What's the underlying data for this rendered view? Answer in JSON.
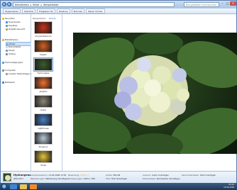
{
  "window": {
    "breadcrumbs": [
      "Bibliotheken",
      "Bilder",
      "Beispielbilder"
    ],
    "search_placeholder": "Beispielbilder durchsuchen",
    "minimize": "–",
    "maximize": "□",
    "close": "✕"
  },
  "toolbar": {
    "items": [
      "Organisieren",
      "Diashow",
      "Freigeben für",
      "Diashow",
      "Brennen",
      "Neuer Ordner"
    ]
  },
  "navpane": {
    "favorites": "Favoriten",
    "fav_items": [
      "Downloads",
      "Desktop",
      "Zuletzt besucht"
    ],
    "libraries": "Bibliotheken",
    "lib_items": [
      "Bilder",
      "Dokumente",
      "Musik",
      "Videos"
    ],
    "homegroup": "Heimnetzgruppe",
    "computer": "Computer",
    "computer_items": [
      "Lokaler Datenträger (C:)"
    ],
    "network": "Netzwerk"
  },
  "filmstrip": {
    "header": "Beispielbilder",
    "arrange_label": "Ordner",
    "items": [
      {
        "label": "Chrysanthemum",
        "color": "#c8351b"
      },
      {
        "label": "Desert",
        "color": "#d2611f"
      },
      {
        "label": "Hydrangeas",
        "color": "#3a5d2b"
      },
      {
        "label": "Jellyfish",
        "color": "#f06f2e"
      },
      {
        "label": "Koala",
        "color": "#8c8778"
      },
      {
        "label": "Lighthouse",
        "color": "#4a7fc2"
      },
      {
        "label": "Penguins",
        "color": "#b6c9d8"
      },
      {
        "label": "Tulips",
        "color": "#e4c33b"
      }
    ]
  },
  "details": {
    "name": "Hydrangeas",
    "type": "JPEG-Bild",
    "date_taken_label": "Aufnahmedatum:",
    "date_taken": "14.03.2008 13:59",
    "tags_label": "Markierungen:",
    "tags": "Markierung hinzufügen",
    "rating_label": "Bewertung:",
    "rating_stars": 3,
    "dimensions_label": "Abmessungen:",
    "dimensions": "1024 x 768",
    "size_label": "Größe:",
    "size": "581 KB",
    "title_label": "Titel:",
    "title": "Titel hinzufügen",
    "authors_label": "Autoren:",
    "authors": "Autor hinzufügen",
    "comments_label": "Kommentare:",
    "comments": "Kommentar hinzufügen",
    "camera_maker_label": "Kamerahersteller:",
    "camera_maker": "Text hinzufügen"
  },
  "taskbar": {
    "time": "09:22",
    "date": "23.06.2009",
    "icons": [
      {
        "name": "internet-explorer-icon",
        "color": "#3f83d4"
      },
      {
        "name": "explorer-icon",
        "color": "#e5c45a"
      },
      {
        "name": "media-player-icon",
        "color": "#f08a2a"
      }
    ]
  }
}
